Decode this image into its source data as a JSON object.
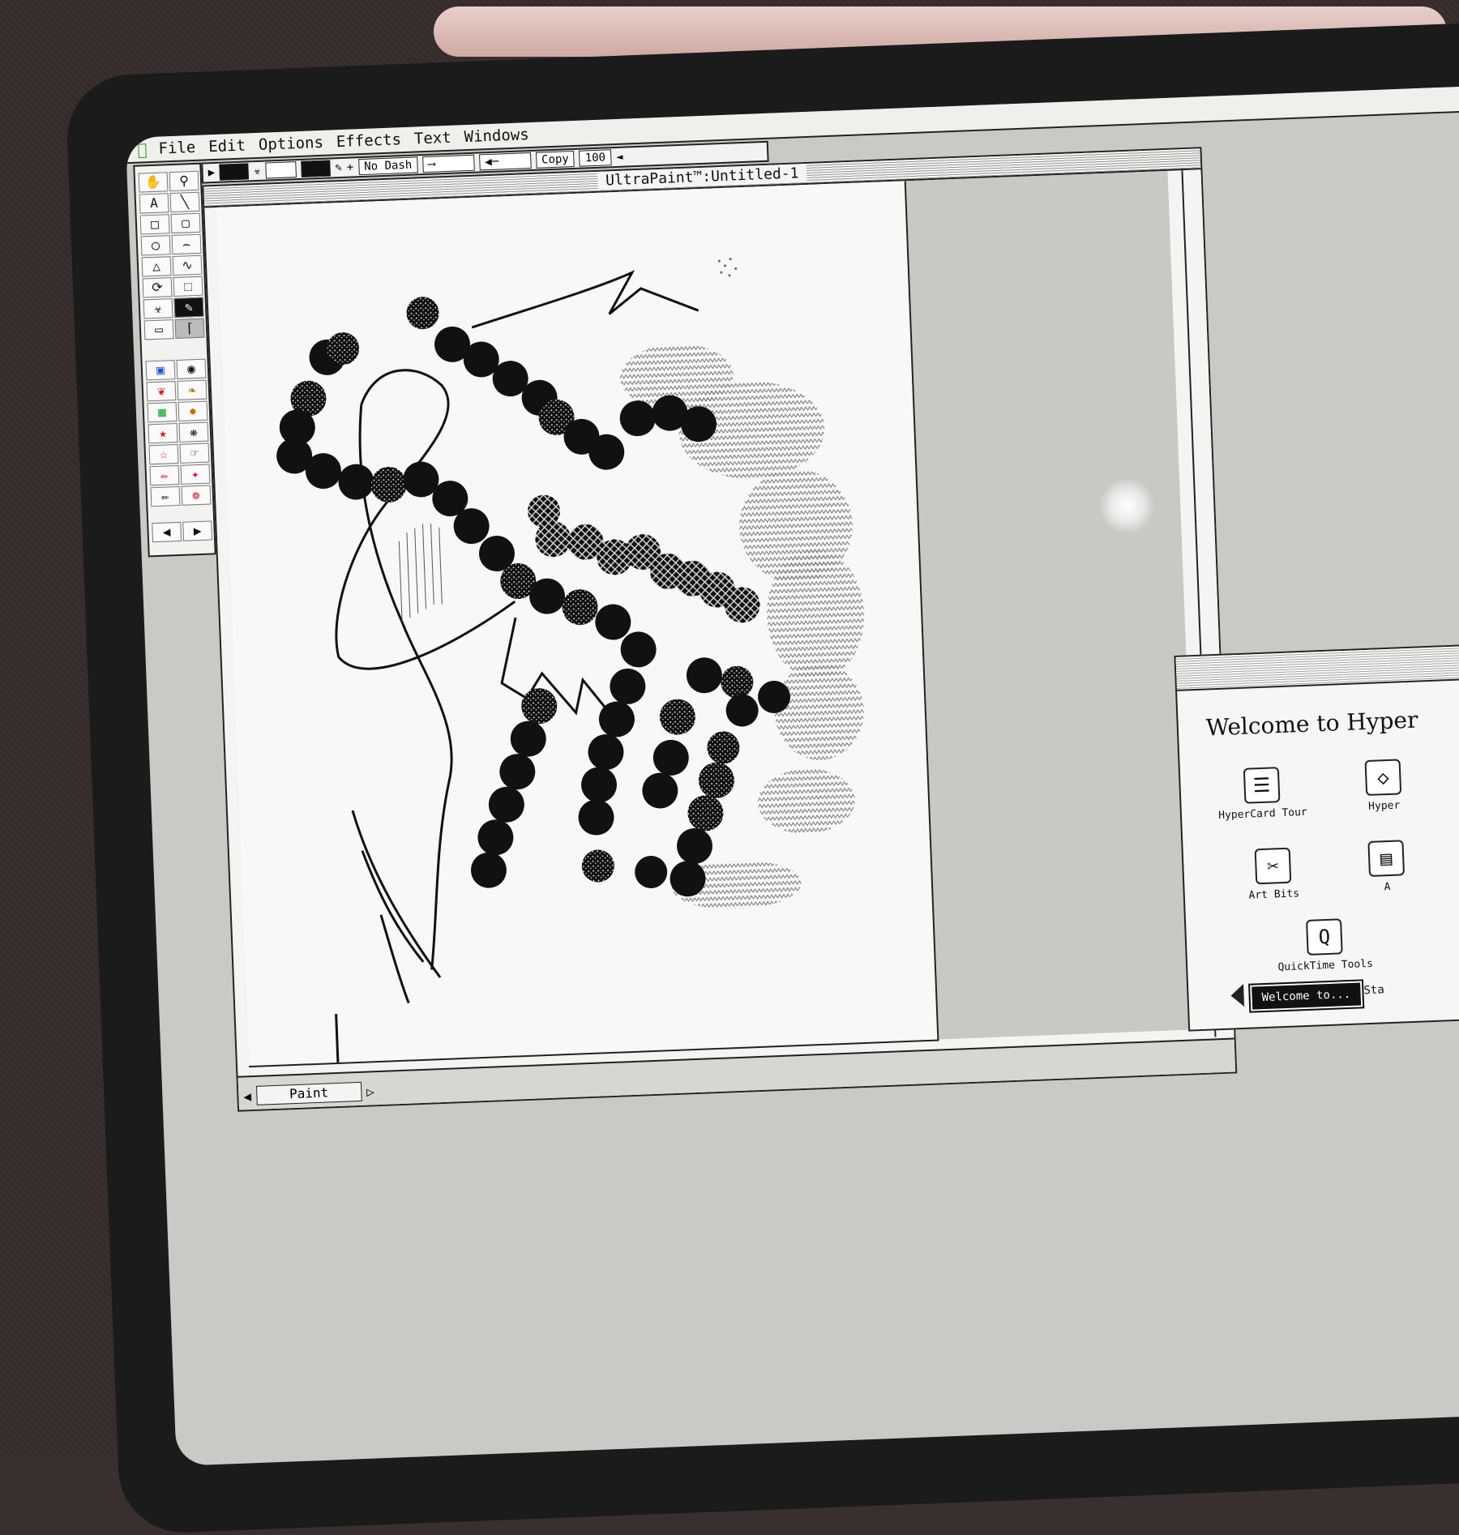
{
  "menubar": {
    "items": [
      "File",
      "Edit",
      "Options",
      "Effects",
      "Text",
      "Windows"
    ]
  },
  "toolbar": {
    "dash_label": "No Dash",
    "copy_label": "Copy",
    "zoom_value": "100"
  },
  "document": {
    "title": "UltraPaint™:Untitled-1",
    "layer_label": "Paint"
  },
  "hypercard": {
    "title": "Welcome to Hyper",
    "icons": [
      "HyperCard Tour",
      "Hyper",
      "Art Bits",
      "A",
      "QuickTime Tools"
    ],
    "nav_button": "Welcome to...",
    "nav_partial": "Sta"
  },
  "colors": {
    "ink": "#111111",
    "paper": "#f8f8f6",
    "desktop": "#c9c9c6",
    "apple_logo": "#3a9a3a"
  },
  "icons": {
    "palette": [
      "hand-icon",
      "zoom-icon",
      "text-icon",
      "line-icon",
      "rectangle-icon",
      "rounded-rect-icon",
      "oval-icon",
      "arc-icon",
      "polygon-icon",
      "freehand-icon",
      "lasso-icon",
      "marquee-icon",
      "bucket-icon",
      "brush-icon",
      "eraser-icon",
      "pencil-icon"
    ]
  }
}
